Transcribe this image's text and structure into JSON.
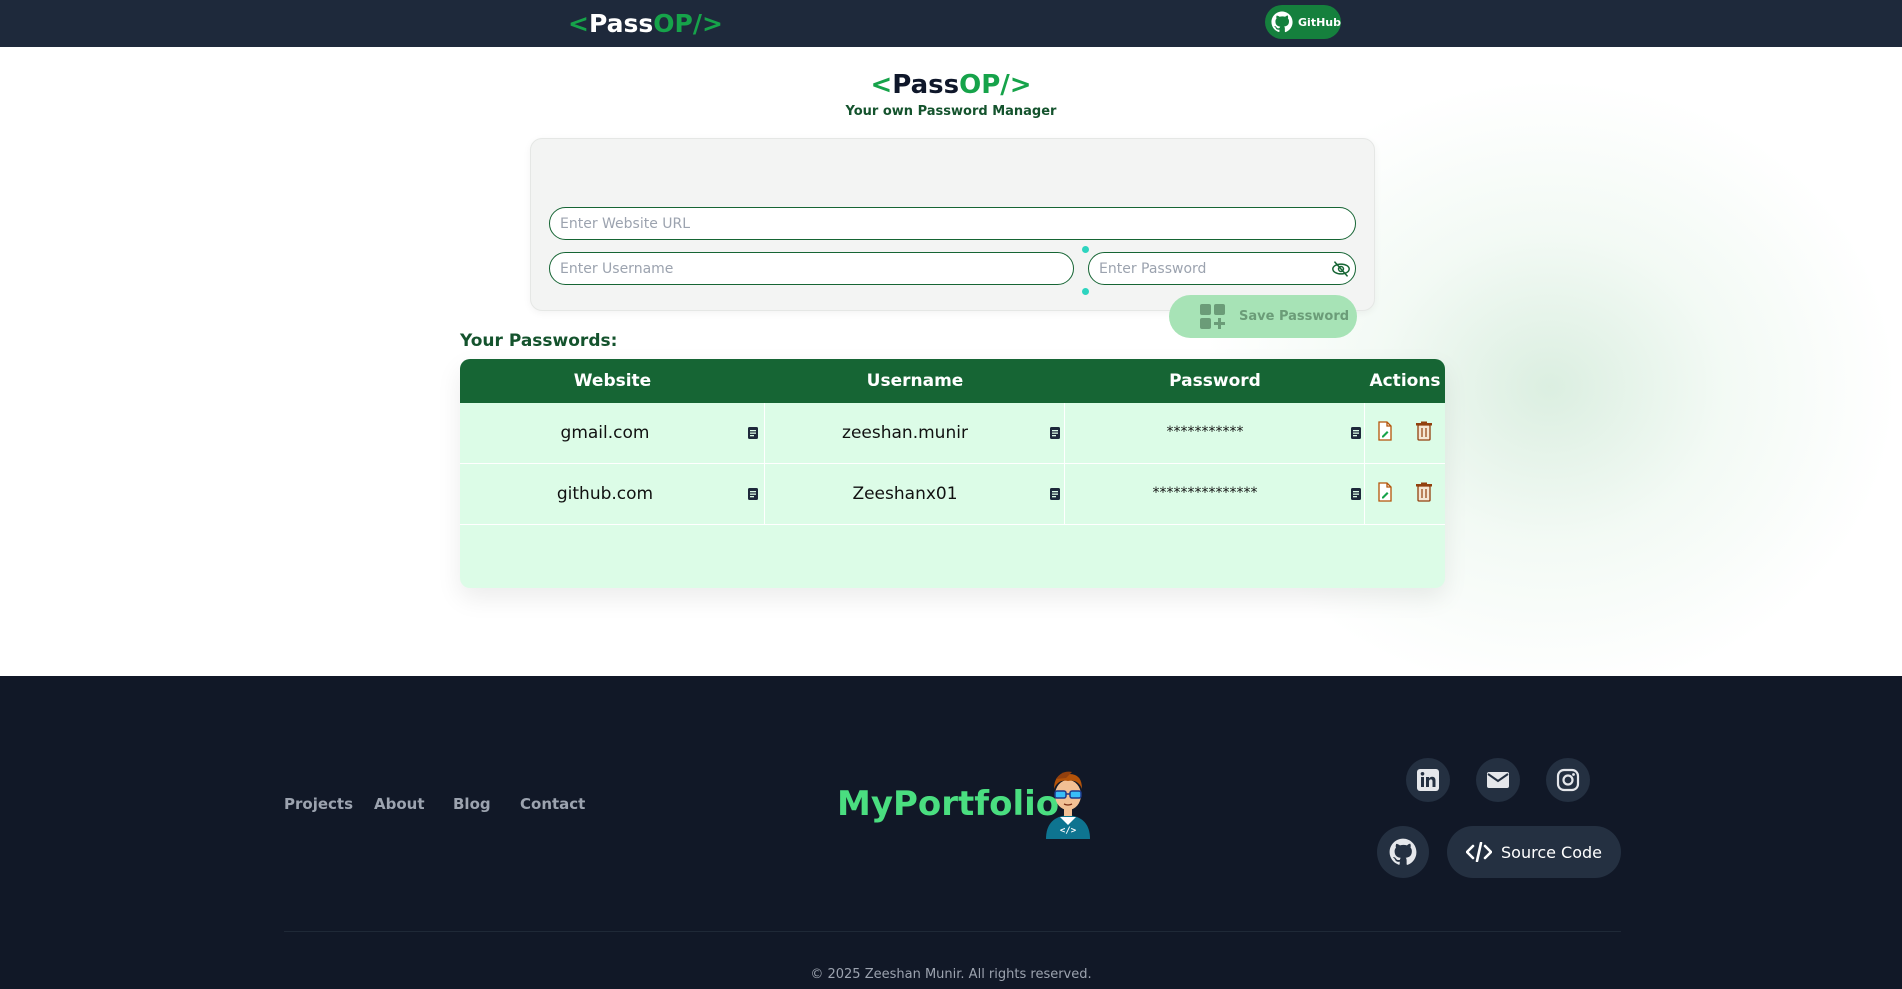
{
  "navbar": {
    "logo": {
      "open": "<",
      "pass": "Pass",
      "op": "OP/>"
    },
    "github_label": "GitHub"
  },
  "hero": {
    "title": {
      "open": "<",
      "pass": "Pass",
      "op": "OP/>"
    },
    "subtitle": "Your own Password Manager"
  },
  "form": {
    "url_placeholder": "Enter Website URL",
    "username_placeholder": "Enter Username",
    "password_placeholder": "Enter Password",
    "save_label": "Save Password"
  },
  "passwords": {
    "title": "Your Passwords:",
    "headers": [
      "Website",
      "Username",
      "Password",
      "Actions"
    ],
    "rows": [
      {
        "website": "gmail.com",
        "username": "zeeshan.munir",
        "password": "***********"
      },
      {
        "website": "github.com",
        "username": "Zeeshanx01",
        "password": "***************"
      }
    ]
  },
  "footer": {
    "links": [
      "Projects",
      "About",
      "Blog",
      "Contact"
    ],
    "brand": "MyPortfolio",
    "social": [
      "linkedin-icon",
      "mail-icon",
      "instagram-icon",
      "github-icon"
    ],
    "source_label": "Source Code",
    "copyright": "© 2025 Zeeshan Munir. All rights reserved."
  },
  "colors": {
    "nav_bg": "#1e293b",
    "accent_green": "#16a34a",
    "table_header": "#166534",
    "table_body": "#dcfce7",
    "footer_bg": "#111827",
    "brand_green": "#4ade80"
  }
}
